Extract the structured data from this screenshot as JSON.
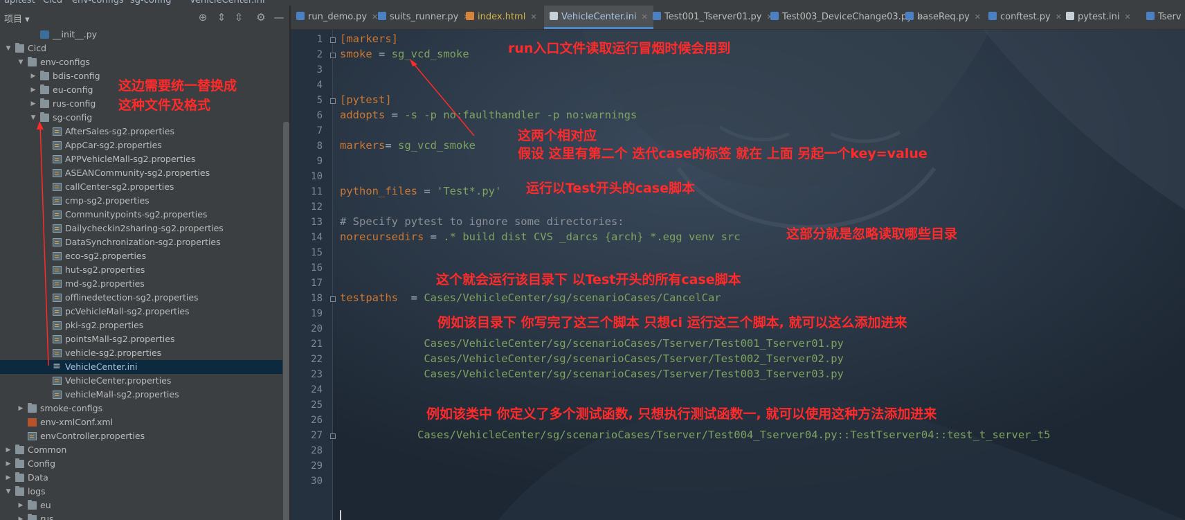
{
  "window": {
    "crumbs": [
      "apitest",
      "Cicd",
      "env-configs",
      "sg-config",
      "VehicleCenter.ini"
    ]
  },
  "panel": {
    "title": "项目"
  },
  "tree": [
    {
      "label": "__init__.py",
      "depth": 2,
      "icon": "py",
      "arrow": ""
    },
    {
      "label": "Cicd",
      "depth": 0,
      "icon": "folder",
      "arrow": "open"
    },
    {
      "label": "env-configs",
      "depth": 1,
      "icon": "folder",
      "arrow": "open"
    },
    {
      "label": "bdis-config",
      "depth": 2,
      "icon": "folder",
      "arrow": "closed"
    },
    {
      "label": "eu-config",
      "depth": 2,
      "icon": "folder",
      "arrow": "closed"
    },
    {
      "label": "rus-config",
      "depth": 2,
      "icon": "folder",
      "arrow": "closed"
    },
    {
      "label": "sg-config",
      "depth": 2,
      "icon": "folder",
      "arrow": "open"
    },
    {
      "label": "AfterSales-sg2.properties",
      "depth": 3,
      "icon": "prop",
      "arrow": ""
    },
    {
      "label": "AppCar-sg2.properties",
      "depth": 3,
      "icon": "prop",
      "arrow": ""
    },
    {
      "label": "APPVehicleMall-sg2.properties",
      "depth": 3,
      "icon": "prop",
      "arrow": ""
    },
    {
      "label": "ASEANCommunity-sg2.properties",
      "depth": 3,
      "icon": "prop",
      "arrow": ""
    },
    {
      "label": "callCenter-sg2.properties",
      "depth": 3,
      "icon": "prop",
      "arrow": ""
    },
    {
      "label": "cmp-sg2.properties",
      "depth": 3,
      "icon": "prop",
      "arrow": ""
    },
    {
      "label": "Communitypoints-sg2.properties",
      "depth": 3,
      "icon": "prop",
      "arrow": ""
    },
    {
      "label": "Dailycheckin2sharing-sg2.properties",
      "depth": 3,
      "icon": "prop",
      "arrow": ""
    },
    {
      "label": "DataSynchronization-sg2.properties",
      "depth": 3,
      "icon": "prop",
      "arrow": ""
    },
    {
      "label": "eco-sg2.properties",
      "depth": 3,
      "icon": "prop",
      "arrow": ""
    },
    {
      "label": "hut-sg2.properties",
      "depth": 3,
      "icon": "prop",
      "arrow": ""
    },
    {
      "label": "md-sg2.properties",
      "depth": 3,
      "icon": "prop",
      "arrow": ""
    },
    {
      "label": "offlinedetection-sg2.properties",
      "depth": 3,
      "icon": "prop",
      "arrow": ""
    },
    {
      "label": "pcVehicleMall-sg2.properties",
      "depth": 3,
      "icon": "prop",
      "arrow": ""
    },
    {
      "label": "pki-sg2.properties",
      "depth": 3,
      "icon": "prop",
      "arrow": ""
    },
    {
      "label": "pointsMall-sg2.properties",
      "depth": 3,
      "icon": "prop",
      "arrow": ""
    },
    {
      "label": "vehicle-sg2.properties",
      "depth": 3,
      "icon": "prop",
      "arrow": ""
    },
    {
      "label": "VehicleCenter.ini",
      "depth": 3,
      "icon": "ini",
      "arrow": "",
      "selected": true
    },
    {
      "label": "VehicleCenter.properties",
      "depth": 3,
      "icon": "prop",
      "arrow": ""
    },
    {
      "label": "vehicleMall-sg2.properties",
      "depth": 3,
      "icon": "prop",
      "arrow": ""
    },
    {
      "label": "smoke-configs",
      "depth": 1,
      "icon": "folder",
      "arrow": "closed"
    },
    {
      "label": "env-xmlConf.xml",
      "depth": 1,
      "icon": "xml",
      "arrow": ""
    },
    {
      "label": "envController.properties",
      "depth": 1,
      "icon": "prop",
      "arrow": ""
    },
    {
      "label": "Common",
      "depth": 0,
      "icon": "folder",
      "arrow": "closed"
    },
    {
      "label": "Config",
      "depth": 0,
      "icon": "folder",
      "arrow": "closed"
    },
    {
      "label": "Data",
      "depth": 0,
      "icon": "folder",
      "arrow": "closed"
    },
    {
      "label": "logs",
      "depth": 0,
      "icon": "folder",
      "arrow": "open"
    },
    {
      "label": "eu",
      "depth": 1,
      "icon": "folder",
      "arrow": "closed"
    },
    {
      "label": "rus",
      "depth": 1,
      "icon": "folder",
      "arrow": "closed"
    }
  ],
  "tabs": [
    {
      "label": "run_demo.py",
      "icon": "py",
      "active": false
    },
    {
      "label": "suits_runner.py",
      "icon": "py",
      "active": false
    },
    {
      "label": "index.html",
      "icon": "html",
      "active": false
    },
    {
      "label": "VehicleCenter.ini",
      "icon": "ini",
      "active": true
    },
    {
      "label": "Test001_Tserver01.py",
      "icon": "py",
      "active": false
    },
    {
      "label": "Test003_DeviceChange03.py",
      "icon": "py",
      "active": false
    },
    {
      "label": "baseReq.py",
      "icon": "py",
      "active": false
    },
    {
      "label": "conftest.py",
      "icon": "py",
      "active": false
    },
    {
      "label": "pytest.ini",
      "icon": "ini",
      "active": false
    },
    {
      "label": "Tserv",
      "icon": "py",
      "active": false
    }
  ],
  "code_lines": [
    {
      "n": "1",
      "text": "[markers]",
      "kind": "section"
    },
    {
      "n": "2",
      "text": "smoke = sg_vcd_smoke",
      "kind": "kv"
    },
    {
      "n": "3",
      "text": "",
      "kind": ""
    },
    {
      "n": "4",
      "text": "",
      "kind": ""
    },
    {
      "n": "5",
      "text": "[pytest]",
      "kind": "section"
    },
    {
      "n": "6",
      "text": "addopts = -s -p no:faulthandler -p no:warnings",
      "kind": "kv"
    },
    {
      "n": "7",
      "text": "",
      "kind": ""
    },
    {
      "n": "8",
      "text": "markers= sg_vcd_smoke",
      "kind": "kv"
    },
    {
      "n": "9",
      "text": "",
      "kind": ""
    },
    {
      "n": "10",
      "text": "",
      "kind": ""
    },
    {
      "n": "11",
      "text": "python_files = 'Test*.py'",
      "kind": "kv"
    },
    {
      "n": "12",
      "text": "",
      "kind": ""
    },
    {
      "n": "13",
      "text": "# Specify pytest to ignore some directories:",
      "kind": "comment"
    },
    {
      "n": "14",
      "text": "norecursedirs = .* build dist CVS _darcs {arch} *.egg venv src",
      "kind": "kv"
    },
    {
      "n": "15",
      "text": "",
      "kind": ""
    },
    {
      "n": "16",
      "text": "",
      "kind": ""
    },
    {
      "n": "17",
      "text": "",
      "kind": ""
    },
    {
      "n": "18",
      "text": "testpaths  = Cases/VehicleCenter/sg/scenarioCases/CancelCar",
      "kind": "kv"
    },
    {
      "n": "19",
      "text": "",
      "kind": ""
    },
    {
      "n": "20",
      "text": "",
      "kind": ""
    },
    {
      "n": "21",
      "text": "             Cases/VehicleCenter/sg/scenarioCases/Tserver/Test001_Tserver01.py",
      "kind": "path"
    },
    {
      "n": "22",
      "text": "             Cases/VehicleCenter/sg/scenarioCases/Tserver/Test002_Tserver02.py",
      "kind": "path"
    },
    {
      "n": "23",
      "text": "             Cases/VehicleCenter/sg/scenarioCases/Tserver/Test003_Tserver03.py",
      "kind": "path"
    },
    {
      "n": "24",
      "text": "",
      "kind": ""
    },
    {
      "n": "25",
      "text": "",
      "kind": ""
    },
    {
      "n": "26",
      "text": "",
      "kind": ""
    },
    {
      "n": "27",
      "text": "            Cases/VehicleCenter/sg/scenarioCases/Tserver/Test004_Tserver04.py::TestTserver04::test_t_server_t5",
      "kind": "path"
    },
    {
      "n": "28",
      "text": "",
      "kind": ""
    },
    {
      "n": "29",
      "text": "",
      "kind": ""
    },
    {
      "n": "30",
      "text": "",
      "kind": ""
    }
  ],
  "annotations": {
    "a1": "run入口文件读取运行冒烟时候会用到",
    "a2": "这边需要统一替换成",
    "a3": "这种文件及格式",
    "a4": "这两个相对应",
    "a5": "假设 这里有第二个 迭代case的标签  就在 上面 另起一个key=value",
    "a6": "运行以Test开头的case脚本",
    "a7": "这部分就是忽略读取哪些目录",
    "a8": "这个就会运行该目录下  以Test开头的所有case脚本",
    "a9": "例如该目录下 你写完了这三个脚本  只想ci 运行这三个脚本, 就可以这么添加进来",
    "a10": "例如该类中  你定义了多个测试函数, 只想执行测试函数一, 就可以使用这种方法添加进来"
  },
  "colors": {
    "annotation": "#ff2a2a",
    "key": "#cc7832",
    "value": "#6a8759",
    "comment": "#808080",
    "selected_row": "#0d293e",
    "active_tab": "#4a88c7"
  }
}
